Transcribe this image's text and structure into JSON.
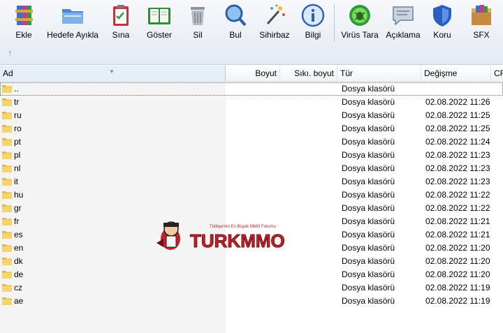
{
  "toolbar": {
    "buttons": [
      {
        "id": "ekle",
        "label": "Ekle",
        "icon": "archive-add-icon"
      },
      {
        "id": "hedefe",
        "label": "Hedefe Ayıkla",
        "icon": "extract-folder-icon"
      },
      {
        "id": "sina",
        "label": "Sına",
        "icon": "test-clipboard-icon"
      },
      {
        "id": "goster",
        "label": "Göster",
        "icon": "view-book-icon"
      },
      {
        "id": "sil",
        "label": "Sil",
        "icon": "trash-icon"
      },
      {
        "id": "bul",
        "label": "Bul",
        "icon": "magnifier-icon"
      },
      {
        "id": "sihirbaz",
        "label": "Sihirbaz",
        "icon": "wizard-wand-icon"
      },
      {
        "id": "bilgi",
        "label": "Bilgi",
        "icon": "info-icon"
      },
      {
        "id": "virus",
        "label": "Virüs Tara",
        "icon": "virus-scan-icon"
      },
      {
        "id": "aciklama",
        "label": "Açıklama",
        "icon": "comment-icon"
      },
      {
        "id": "koru",
        "label": "Koru",
        "icon": "shield-icon"
      },
      {
        "id": "sfx",
        "label": "SFX",
        "icon": "sfx-box-icon"
      }
    ]
  },
  "columns": {
    "name": "Ad",
    "size": "Boyut",
    "packed": "Sıkı. boyut",
    "type": "Tür",
    "modified": "Değişme",
    "crc": "CR"
  },
  "files": [
    {
      "name": "..",
      "type": "Dosya klasörü",
      "modified": ""
    },
    {
      "name": "tr",
      "type": "Dosya klasörü",
      "modified": "02.08.2022 11:26"
    },
    {
      "name": "ru",
      "type": "Dosya klasörü",
      "modified": "02.08.2022 11:25"
    },
    {
      "name": "ro",
      "type": "Dosya klasörü",
      "modified": "02.08.2022 11:25"
    },
    {
      "name": "pt",
      "type": "Dosya klasörü",
      "modified": "02.08.2022 11:24"
    },
    {
      "name": "pl",
      "type": "Dosya klasörü",
      "modified": "02.08.2022 11:23"
    },
    {
      "name": "nl",
      "type": "Dosya klasörü",
      "modified": "02.08.2022 11:23"
    },
    {
      "name": "it",
      "type": "Dosya klasörü",
      "modified": "02.08.2022 11:23"
    },
    {
      "name": "hu",
      "type": "Dosya klasörü",
      "modified": "02.08.2022 11:22"
    },
    {
      "name": "gr",
      "type": "Dosya klasörü",
      "modified": "02.08.2022 11:22"
    },
    {
      "name": "fr",
      "type": "Dosya klasörü",
      "modified": "02.08.2022 11:21"
    },
    {
      "name": "es",
      "type": "Dosya klasörü",
      "modified": "02.08.2022 11:21"
    },
    {
      "name": "en",
      "type": "Dosya klasörü",
      "modified": "02.08.2022 11:20"
    },
    {
      "name": "dk",
      "type": "Dosya klasörü",
      "modified": "02.08.2022 11:20"
    },
    {
      "name": "de",
      "type": "Dosya klasörü",
      "modified": "02.08.2022 11:20"
    },
    {
      "name": "cz",
      "type": "Dosya klasörü",
      "modified": "02.08.2022 11:19"
    },
    {
      "name": "ae",
      "type": "Dosya klasörü",
      "modified": "02.08.2022 11:19"
    }
  ],
  "watermark": {
    "tagline": "Türkiye'nin En Büyük MMO Forumu",
    "brand": "TURKMMO",
    "colors": {
      "primary": "#c8202a",
      "dark": "#6b1116"
    }
  }
}
